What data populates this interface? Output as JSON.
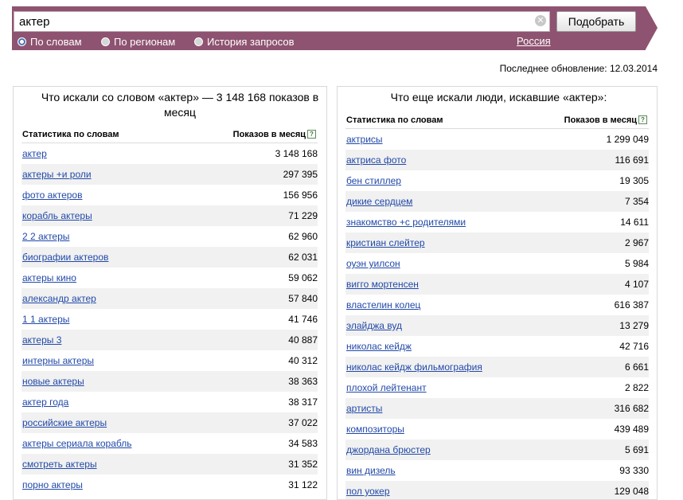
{
  "search": {
    "query": "актер",
    "button": "Подобрать"
  },
  "modes": [
    {
      "label": "По словам",
      "selected": true
    },
    {
      "label": "По регионам",
      "selected": false
    },
    {
      "label": "История запросов",
      "selected": false
    }
  ],
  "region": "Россия",
  "last_update": "Последнее обновление: 12.03.2014",
  "left_panel": {
    "title": "Что искали со словом «актер» — 3 148 168 показов в месяц",
    "col_word": "Статистика по словам",
    "col_count": "Показов в месяц",
    "rows": [
      {
        "phrase": "актер",
        "count": "3 148 168"
      },
      {
        "phrase": "актеры +и роли",
        "count": "297 395"
      },
      {
        "phrase": "фото актеров",
        "count": "156 956"
      },
      {
        "phrase": "корабль актеры",
        "count": "71 229"
      },
      {
        "phrase": "2 2 актеры",
        "count": "62 960"
      },
      {
        "phrase": "биографии актеров",
        "count": "62 031"
      },
      {
        "phrase": "актеры кино",
        "count": "59 062"
      },
      {
        "phrase": "александр актер",
        "count": "57 840"
      },
      {
        "phrase": "1 1 актеры",
        "count": "41 746"
      },
      {
        "phrase": "актеры 3",
        "count": "40 887"
      },
      {
        "phrase": "интерны актеры",
        "count": "40 312"
      },
      {
        "phrase": "новые актеры",
        "count": "38 363"
      },
      {
        "phrase": "актер года",
        "count": "38 317"
      },
      {
        "phrase": "российские актеры",
        "count": "37 022"
      },
      {
        "phrase": "актеры сериала корабль",
        "count": "34 583"
      },
      {
        "phrase": "смотреть актеры",
        "count": "31 352"
      },
      {
        "phrase": "порно актеры",
        "count": "31 122"
      }
    ]
  },
  "right_panel": {
    "title": "Что еще искали люди, искавшие «актер»:",
    "col_word": "Статистика по словам",
    "col_count": "Показов в месяц",
    "rows": [
      {
        "phrase": "актрисы",
        "count": "1 299 049"
      },
      {
        "phrase": "актриса фото",
        "count": "116 691"
      },
      {
        "phrase": "бен стиллер",
        "count": "19 305"
      },
      {
        "phrase": "дикие сердцем",
        "count": "7 354"
      },
      {
        "phrase": "знакомство +с родителями",
        "count": "14 611"
      },
      {
        "phrase": "кристиан слейтер",
        "count": "2 967"
      },
      {
        "phrase": "оуэн уилсон",
        "count": "5 984"
      },
      {
        "phrase": "вигго мортенсен",
        "count": "4 107"
      },
      {
        "phrase": "властелин колец",
        "count": "616 387"
      },
      {
        "phrase": "элайджа вуд",
        "count": "13 279"
      },
      {
        "phrase": "николас кейдж",
        "count": "42 716"
      },
      {
        "phrase": "николас кейдж фильмография",
        "count": "6 661"
      },
      {
        "phrase": "плохой лейтенант",
        "count": "2 822"
      },
      {
        "phrase": "артисты",
        "count": "316 682"
      },
      {
        "phrase": "композиторы",
        "count": "439 489"
      },
      {
        "phrase": "джордана брюстер",
        "count": "5 691"
      },
      {
        "phrase": "вин дизель",
        "count": "93 330"
      },
      {
        "phrase": "пол уокер",
        "count": "129 048"
      }
    ]
  }
}
